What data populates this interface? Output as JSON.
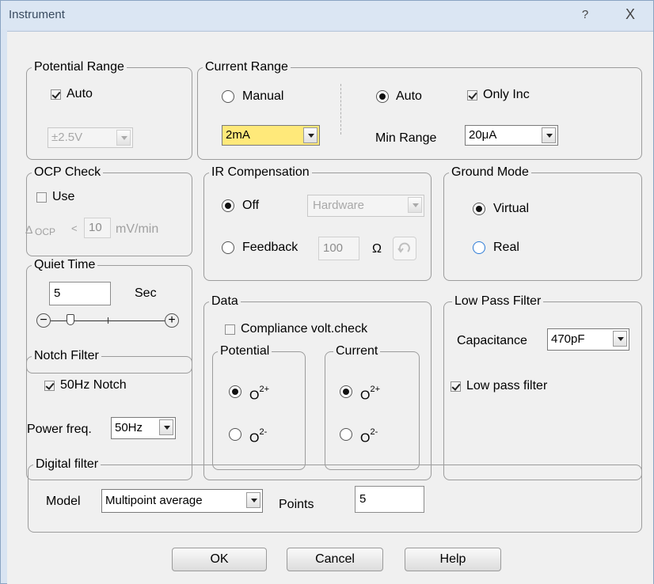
{
  "window": {
    "title": "Instrument",
    "help_label": "?",
    "close_label": "X"
  },
  "potential_range": {
    "legend": "Potential Range",
    "auto_label": "Auto",
    "auto_checked": true,
    "range_value": "±2.5V"
  },
  "current_range": {
    "legend": "Current Range",
    "manual_label": "Manual",
    "auto_label": "Auto",
    "selected_mode": "Auto",
    "manual_value": "2mA",
    "only_inc_label": "Only Inc",
    "only_inc_checked": true,
    "min_range_label": "Min Range",
    "min_range_value": "20μA"
  },
  "ocp_check": {
    "legend": "OCP Check",
    "use_label": "Use",
    "use_checked": false,
    "delta_label": "Δ",
    "ocp_label": "OCP",
    "lt": "<",
    "value": "10",
    "unit": "mV/min"
  },
  "ir_compensation": {
    "legend": "IR Compensation",
    "off_label": "Off",
    "feedback_label": "Feedback",
    "selected": "Off",
    "mode_value": "Hardware",
    "feedback_value": "100",
    "unit": "Ω"
  },
  "ground_mode": {
    "legend": "Ground Mode",
    "virtual_label": "Virtual",
    "real_label": "Real",
    "selected": "Virtual"
  },
  "quiet_time": {
    "legend": "Quiet Time",
    "value": "5",
    "unit": "Sec",
    "minus_label": "−",
    "plus_label": "+"
  },
  "data": {
    "legend": "Data",
    "compliance_label": "Compliance volt.check",
    "compliance_checked": false,
    "potential": {
      "legend": "Potential",
      "opt1_base": "O",
      "opt1_sup": "2+",
      "opt2_base": "O",
      "opt2_sup": "2-",
      "selected": "2+"
    },
    "current": {
      "legend": "Current",
      "opt1_base": "O",
      "opt1_sup": "2+",
      "opt2_base": "O",
      "opt2_sup": "2-",
      "selected": "2+"
    }
  },
  "low_pass_filter": {
    "legend": "Low Pass Filter",
    "capacitance_label": "Capacitance",
    "capacitance_value": "470pF",
    "enable_label": "Low pass filter",
    "enable_checked": true
  },
  "notch_filter": {
    "legend": "Notch Filter",
    "notch_label": "50Hz Notch",
    "notch_checked": true,
    "power_label": "Power freq.",
    "power_value": "50Hz"
  },
  "digital_filter": {
    "legend": "Digital filter",
    "model_label": "Model",
    "model_value": "Multipoint average",
    "points_label": "Points",
    "points_value": "5"
  },
  "buttons": {
    "ok": "OK",
    "cancel": "Cancel",
    "help": "Help"
  },
  "colors": {
    "highlight_yellow": "#ffe97a",
    "title_bar": "#dbe6f3",
    "dialog_bg": "#f0f0f0",
    "radio_blue": "#2c7bd6"
  }
}
